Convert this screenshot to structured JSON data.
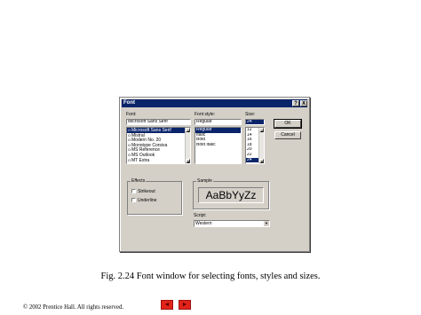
{
  "dialog": {
    "title": "Font",
    "help_glyph": "?",
    "close_glyph": "X",
    "font_label": "Font:",
    "font_value": "Microsoft Sans Serif",
    "fonts": [
      "Microsoft Sans Serif",
      "Mistral",
      "Modern No. 20",
      "Monotype Corsiva",
      "MS Reference",
      "MS Outlook",
      "MT Extra"
    ],
    "font_selected": 0,
    "style_label": "Font style:",
    "style_value": "Regular",
    "styles": [
      "Regular",
      "Italic",
      "Bold",
      "Bold Italic"
    ],
    "style_selected": 0,
    "size_label": "Size:",
    "size_value": "24",
    "sizes": [
      "12",
      "14",
      "16",
      "18",
      "20",
      "22",
      "24"
    ],
    "size_selected": 6,
    "ok_label": "OK",
    "cancel_label": "Cancel",
    "effects_label": "Effects",
    "strikeout_label": "Strikeout",
    "underline_label": "Underline",
    "sample_label": "Sample",
    "sample_text": "AaBbYyZz",
    "script_label": "Script:",
    "script_value": "Western"
  },
  "slide": {
    "caption": "Fig. 2.24     Font window for selecting fonts, styles and sizes.",
    "copyright": "©  2002 Prentice Hall.  All rights reserved.",
    "prev_glyph": "◄",
    "next_glyph": "►"
  },
  "icons": {
    "font_type": "opentype-icon",
    "scroll_up": "arrow-up-icon",
    "scroll_down": "arrow-down-icon"
  },
  "colors": {
    "titlebar": "#0a246a",
    "dialog_face": "#d4d0c8",
    "nav_button": "#e2231a"
  }
}
